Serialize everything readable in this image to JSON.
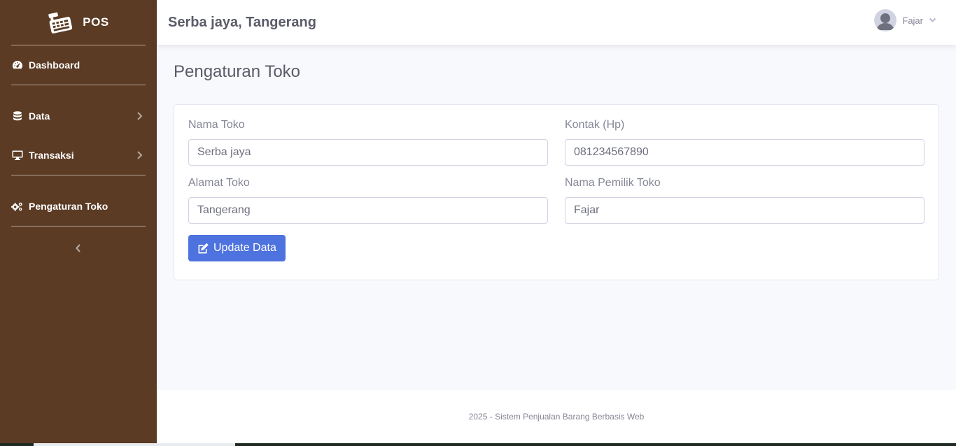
{
  "sidebar": {
    "brand": "POS",
    "items": [
      {
        "label": "Dashboard",
        "icon": "dashboard-icon"
      },
      {
        "label": "Data",
        "icon": "database-icon"
      },
      {
        "label": "Transaksi",
        "icon": "desktop-icon"
      },
      {
        "label": "Pengaturan Toko",
        "icon": "cogs-icon"
      }
    ]
  },
  "topbar": {
    "title": "Serba jaya, Tangerang",
    "user_name": "Fajar"
  },
  "page": {
    "title": "Pengaturan Toko"
  },
  "form": {
    "nama_toko": {
      "label": "Nama Toko",
      "value": "Serba jaya"
    },
    "kontak": {
      "label": "Kontak (Hp)",
      "value": "081234567890"
    },
    "alamat": {
      "label": "Alamat Toko",
      "value": "Tangerang"
    },
    "pemilik": {
      "label": "Nama Pemilik Toko",
      "value": "Fajar"
    },
    "submit_label": "Update Data"
  },
  "footer": {
    "text": "2025 - Sistem Penjualan Barang Berbasis Web"
  },
  "colors": {
    "sidebar_bg": "#5b3b24",
    "primary": "#4e73df",
    "page_bg": "#f8f9fc"
  }
}
